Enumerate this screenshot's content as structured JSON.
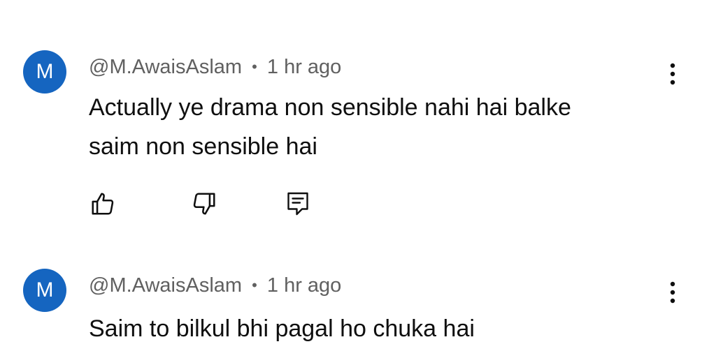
{
  "comments": [
    {
      "avatar_letter": "M",
      "author": "@M.AwaisAslam",
      "separator": "•",
      "time": "1 hr ago",
      "text_line_1": "Actually ye drama non sensible nahi hai  balke",
      "text_line_2": "saim non sensible hai",
      "avatar_color": "#1565c0",
      "actions": {
        "like_icon": "thumbs-up-icon",
        "dislike_icon": "thumbs-down-icon",
        "reply_icon": "reply-comment-icon",
        "menu_icon": "more-vert-icon"
      }
    },
    {
      "avatar_letter": "M",
      "author": "@M.AwaisAslam",
      "separator": "•",
      "time": "1 hr ago",
      "text_line_1": "Saim to bilkul bhi pagal ho chuka hai",
      "avatar_color": "#1565c0",
      "actions": {
        "menu_icon": "more-vert-icon"
      }
    }
  ]
}
